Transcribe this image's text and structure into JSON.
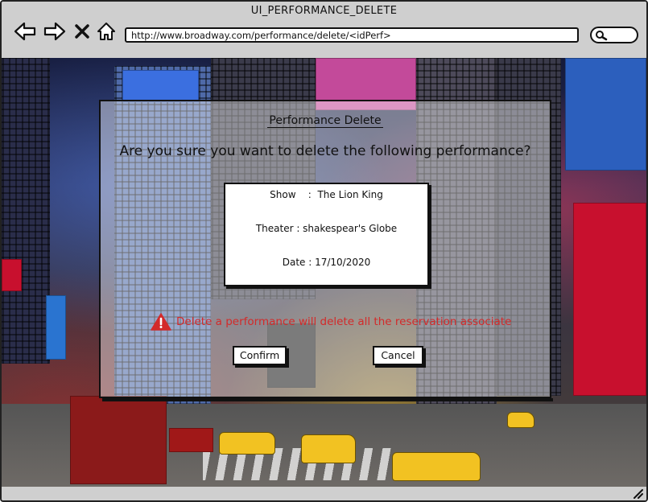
{
  "window": {
    "title": "UI_PERFORMANCE_DELETE"
  },
  "browser": {
    "url": "http://www.broadway.com/performance/delete/<idPerf>",
    "icons": [
      "back-arrow-icon",
      "forward-arrow-icon",
      "close-x-icon",
      "home-icon",
      "search-icon"
    ]
  },
  "dialog": {
    "title": "Performance Delete",
    "question": "Are you sure you want to delete the following performance?",
    "show_line": "Show    :  The Lion King",
    "theater_line": "Theater : shakespear's Globe",
    "date_line": "Date : 17/10/2020",
    "warning": "Delete a performance will delete all the reservation associate",
    "confirm_label": "Confirm",
    "cancel_label": "Cancel"
  },
  "colors": {
    "warning": "#d32a2a",
    "chrome": "#cfcfcf"
  }
}
